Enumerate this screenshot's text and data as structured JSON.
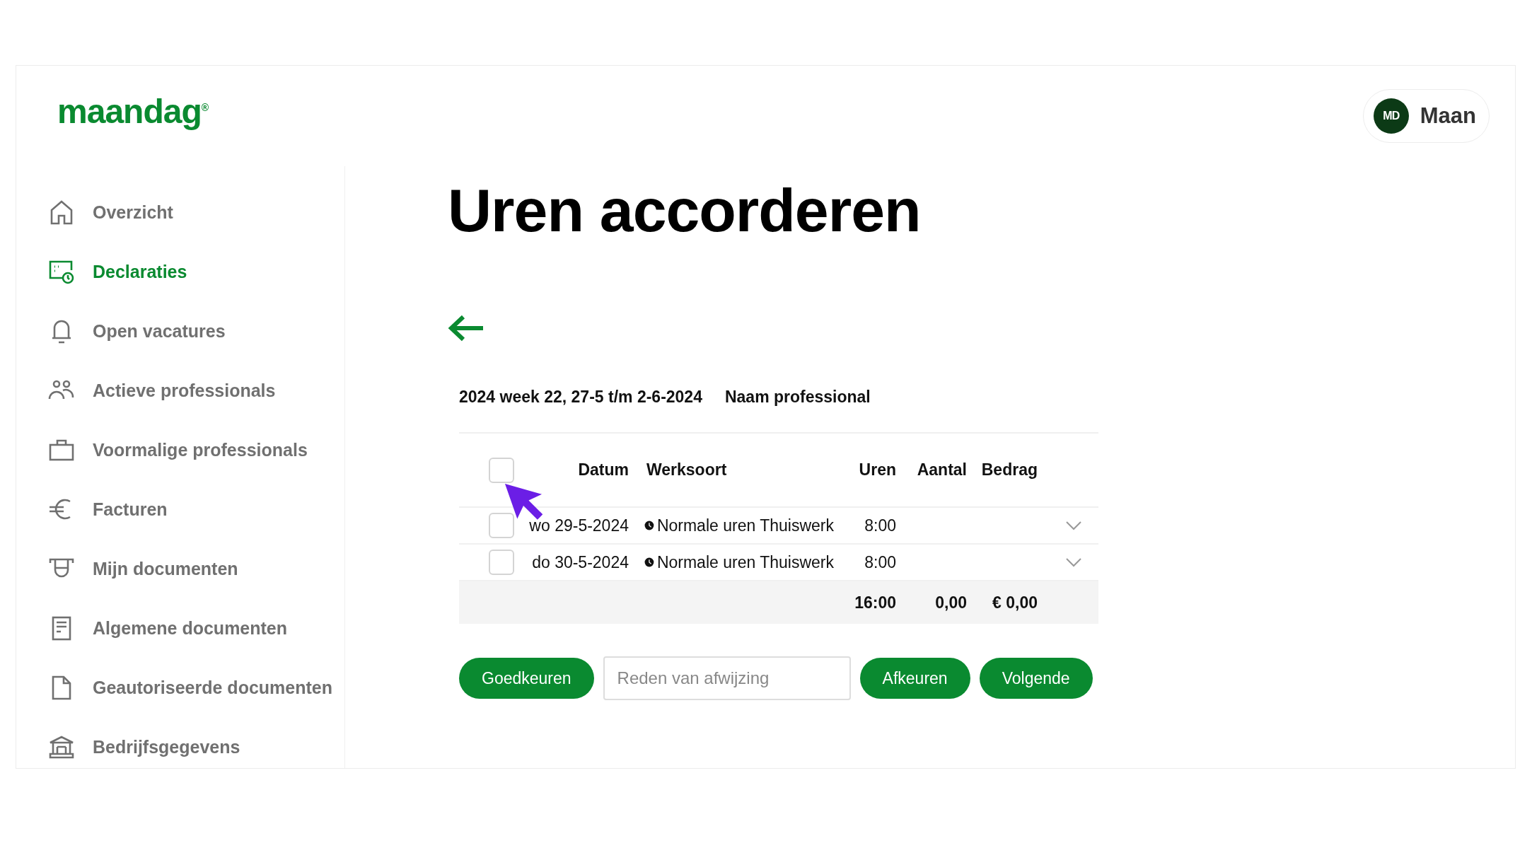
{
  "logo": {
    "text": "maandag$^{®}$"
  },
  "user": {
    "initials": "MD",
    "name": "Maan"
  },
  "sidebar": {
    "items": [
      {
        "kind": "home",
        "label": "Overzicht",
        "selected": false
      },
      {
        "kind": "declaration",
        "label": "Declaraties",
        "selected": true
      },
      {
        "kind": "bell",
        "label": "Open vacatures",
        "selected": false
      },
      {
        "kind": "people",
        "label": "Actieve professionals",
        "selected": false
      },
      {
        "kind": "briefcase",
        "label": "Voormalige professionals",
        "selected": false
      },
      {
        "kind": "euro",
        "label": "Facturen",
        "selected": false
      },
      {
        "kind": "cap",
        "label": "Mijn documenten",
        "selected": false
      },
      {
        "kind": "document",
        "label": "Algemene documenten",
        "selected": false
      },
      {
        "kind": "file",
        "label": "Geautoriseerde documenten",
        "selected": false
      },
      {
        "kind": "bank",
        "label": "Bedrijfsgegevens",
        "selected": false
      }
    ]
  },
  "page": {
    "title": "Uren accorderen",
    "period": "2024 week 22, 27-5 t/m 2-6-2024",
    "professional": "Naam professional"
  },
  "table": {
    "select_all": {
      "checked": false
    },
    "columns": [
      "Datum",
      "Werksoort",
      "Uren",
      "Aantal",
      "Bedrag"
    ],
    "rows": [
      {
        "checked": false,
        "date": "wo 29-5-2024",
        "type": "Normale uren Thuiswerk",
        "hours": "8:00",
        "expanded": false
      },
      {
        "checked": false,
        "date": "do 30-5-2024",
        "type": "Normale uren Thuiswerk",
        "hours": "8:00",
        "expanded": false
      }
    ],
    "totals": {
      "hours": "16:00",
      "count": "0,00",
      "amount": "€ 0,00"
    }
  },
  "actions": {
    "approve": "Goedkeuren",
    "reason": {
      "placeholder": "Reden van afwijzing"
    },
    "reject": "Afkeuren",
    "next": "Volgende"
  }
}
